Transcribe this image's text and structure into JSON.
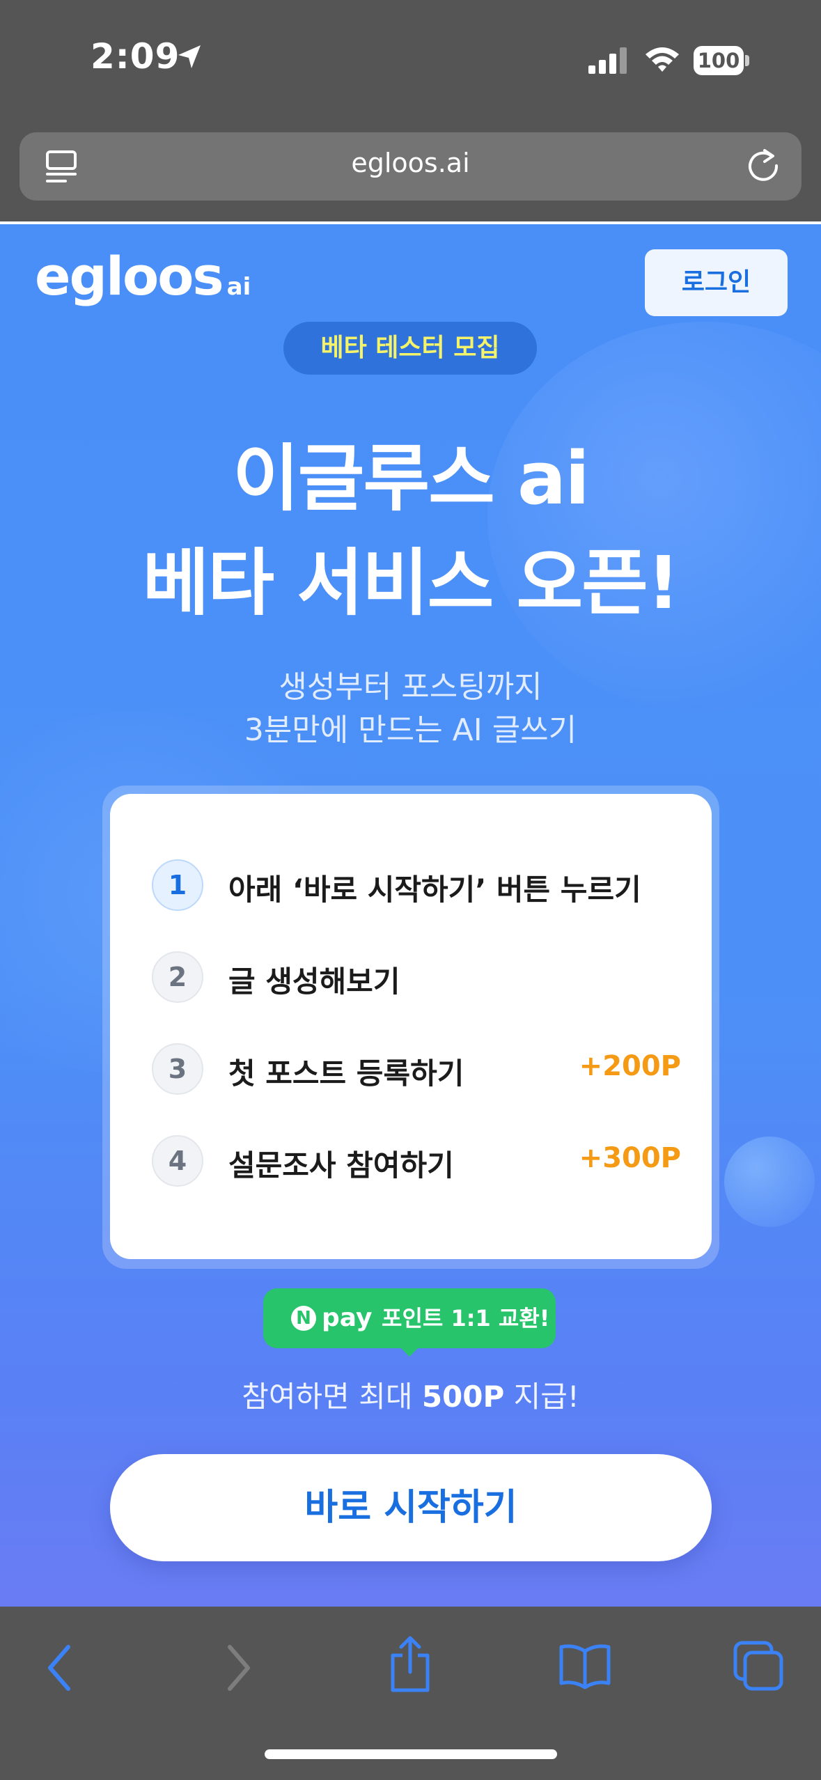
{
  "status_bar": {
    "time": "2:09",
    "battery": "100"
  },
  "browser": {
    "url": "egloos.ai"
  },
  "page": {
    "logo": "egloos",
    "logo_sub": "ai",
    "login_button": "로그인",
    "beta_badge": "베타 테스터 모집",
    "headline_line1": "이글루스 ai",
    "headline_line2": "베타 서비스 오픈!",
    "subline_line1": "생성부터 포스팅까지",
    "subline_line2": "3분만에 만드는 AI 글쓰기",
    "steps": [
      {
        "num": "1",
        "label": "아래 ‘바로 시작하기’ 버튼 누르기",
        "reward": ""
      },
      {
        "num": "2",
        "label": "글 생성해보기",
        "reward": ""
      },
      {
        "num": "3",
        "label": "첫 포스트 등록하기",
        "reward": "+200P"
      },
      {
        "num": "4",
        "label": "설문조사 참여하기",
        "reward": "+300P"
      }
    ],
    "npay_icon": "N",
    "npay_pay": "pay",
    "npay_text": "포인트 1:1 교환!",
    "reward_prefix": "참여하면 최대 ",
    "reward_amount": "500P",
    "reward_suffix": " 지급!",
    "start_button": "바로 시작하기"
  },
  "colors": {
    "accent": "#1a6fe0",
    "page_bg": "#4a8ff8",
    "badge_text": "#f5f36a",
    "reward": "#f59a14",
    "npay": "#27c46b"
  },
  "icons": [
    "location-arrow-icon",
    "signal-icon",
    "wifi-icon",
    "battery-icon",
    "reader-icon",
    "reload-icon",
    "back-icon",
    "forward-icon",
    "share-icon",
    "bookmarks-icon",
    "tabs-icon"
  ]
}
